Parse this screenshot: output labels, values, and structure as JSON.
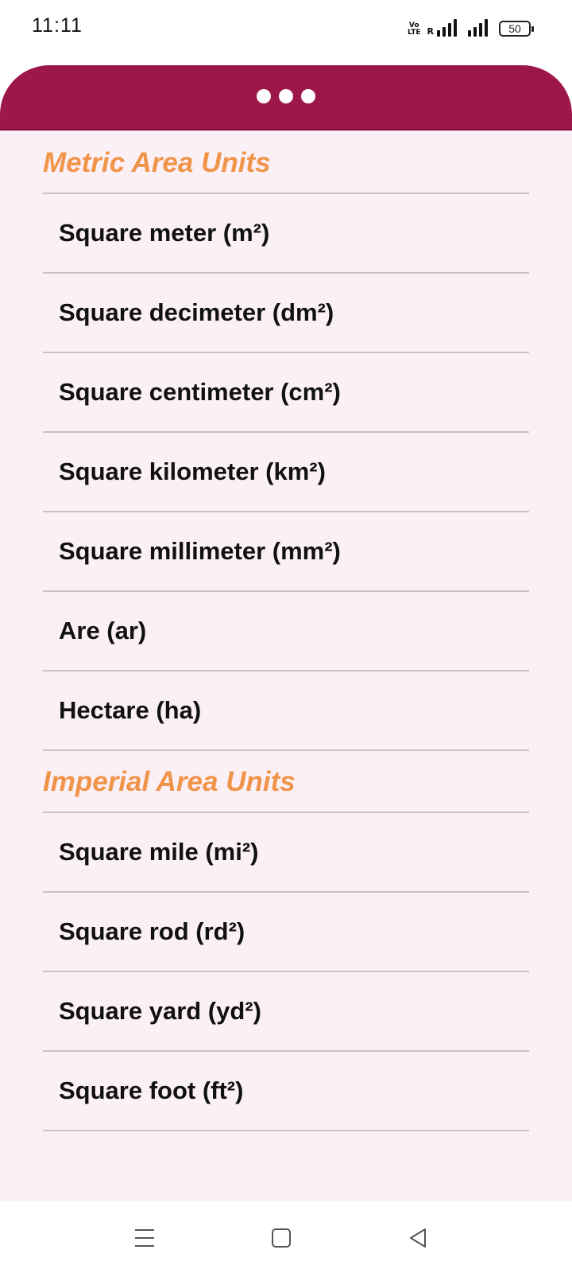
{
  "status_bar": {
    "time": "11:11",
    "volte_top": "Vo",
    "volte_bottom": "LTE",
    "roaming": "R",
    "battery": "50"
  },
  "header": {
    "icon": "more-dots-icon",
    "accent_color": "#9e174b"
  },
  "sections": [
    {
      "title": "Metric Area Units",
      "items": [
        "Square meter (m²)",
        "Square decimeter (dm²)",
        "Square centimeter (cm²)",
        "Square kilometer (km²)",
        "Square millimeter (mm²)",
        "Are (ar)",
        "Hectare (ha)"
      ]
    },
    {
      "title": "Imperial Area Units",
      "items": [
        "Square mile (mi²)",
        "Square rod (rd²)",
        "Square yard (yd²)",
        "Square foot (ft²)"
      ]
    }
  ],
  "colors": {
    "section_title": "#f0944a",
    "background": "#fbf0f6",
    "divider": "#c9c3c6"
  },
  "nav": {
    "menu_icon": "menu-icon",
    "home_icon": "home-square-icon",
    "back_icon": "back-triangle-icon"
  }
}
